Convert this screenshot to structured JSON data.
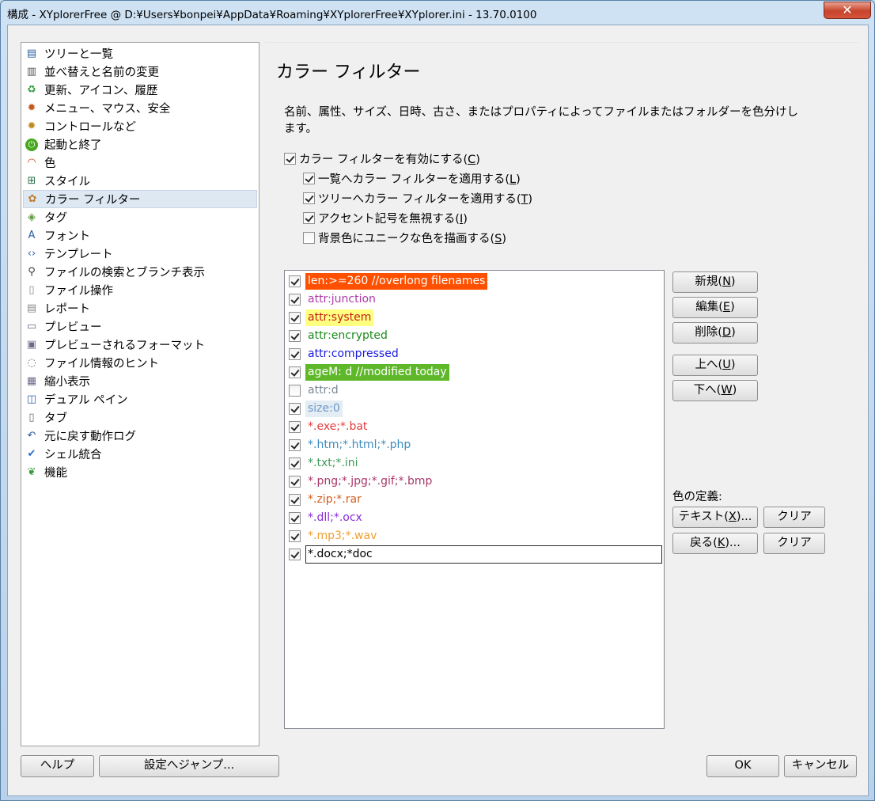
{
  "window": {
    "title": "構成 - XYplorerFree @ D:¥Users¥bonpei¥AppData¥Roaming¥XYplorerFree¥XYplorer.ini - 13.70.0100",
    "close_glyph": "✕"
  },
  "sidebar": {
    "items": [
      {
        "label": "ツリーと一覧",
        "icon": "tree-list-icon"
      },
      {
        "label": "並べ替えと名前の変更",
        "icon": "sort-icon"
      },
      {
        "label": "更新、アイコン、履歴",
        "icon": "refresh-icon"
      },
      {
        "label": "メニュー、マウス、安全",
        "icon": "menu-gear-icon"
      },
      {
        "label": "コントロールなど",
        "icon": "controls-gear-icon"
      },
      {
        "label": "起動と終了",
        "icon": "power-icon"
      },
      {
        "label": "色",
        "icon": "rainbow-icon"
      },
      {
        "label": "スタイル",
        "icon": "grid-style-icon"
      },
      {
        "label": "カラー フィルター",
        "icon": "color-filter-icon"
      },
      {
        "label": "タグ",
        "icon": "tag-icon"
      },
      {
        "label": "フォント",
        "icon": "font-icon"
      },
      {
        "label": "テンプレート",
        "icon": "code-brackets-icon"
      },
      {
        "label": "ファイルの検索とブランチ表示",
        "icon": "magnifier-icon"
      },
      {
        "label": "ファイル操作",
        "icon": "document-icon"
      },
      {
        "label": "レポート",
        "icon": "report-icon"
      },
      {
        "label": "プレビュー",
        "icon": "preview-icon"
      },
      {
        "label": "プレビューされるフォーマット",
        "icon": "formats-icon"
      },
      {
        "label": "ファイル情報のヒント",
        "icon": "speech-bubble-icon"
      },
      {
        "label": "縮小表示",
        "icon": "thumbnails-icon"
      },
      {
        "label": "デュアル ペイン",
        "icon": "dual-pane-icon"
      },
      {
        "label": "タブ",
        "icon": "tab-page-icon"
      },
      {
        "label": "元に戻す動作ログ",
        "icon": "undo-icon"
      },
      {
        "label": "シェル統合",
        "icon": "checkmark-icon"
      },
      {
        "label": "機能",
        "icon": "leaf-icon"
      }
    ],
    "selected_index": 8
  },
  "main": {
    "title": "カラー フィルター",
    "description": "名前、属性、サイズ、日時、古さ、またはプロパティによってファイルまたはフォルダーを色分けします。",
    "options": {
      "enable": {
        "label": "カラー フィルターを有効にする",
        "key": "C",
        "checked": true
      },
      "apply_list": {
        "label": "一覧へカラー フィルターを適用する",
        "key": "L",
        "checked": true
      },
      "apply_tree": {
        "label": "ツリーへカラー フィルターを適用する",
        "key": "T",
        "checked": true
      },
      "ignore_diacritics": {
        "label": "アクセント記号を無視する",
        "key": "I",
        "checked": true
      },
      "unique_bg": {
        "label": "背景色にユニークな色を描画する",
        "key": "S",
        "checked": false
      }
    },
    "filters": [
      {
        "text": "len:>=260 //overlong filenames",
        "checked": true,
        "fg": "#ffffff",
        "bg": "#ff5000"
      },
      {
        "text": "attr:junction",
        "checked": true,
        "fg": "#b03aa8",
        "bg": ""
      },
      {
        "text": "attr:system",
        "checked": true,
        "fg": "#c71c1c",
        "bg": "#ffff80"
      },
      {
        "text": "attr:encrypted",
        "checked": true,
        "fg": "#1a8a1a",
        "bg": ""
      },
      {
        "text": "attr:compressed",
        "checked": true,
        "fg": "#1a1ae0",
        "bg": ""
      },
      {
        "text": "ageM: d //modified today",
        "checked": true,
        "fg": "#ffffff",
        "bg": "#5fb82a"
      },
      {
        "text": "attr:d",
        "checked": false,
        "fg": "#7b8893",
        "bg": ""
      },
      {
        "text": "size:0",
        "checked": true,
        "fg": "#6a9ac8",
        "bg": "#e4ecf4"
      },
      {
        "text": "*.exe;*.bat",
        "checked": true,
        "fg": "#e03c3c",
        "bg": ""
      },
      {
        "text": "*.htm;*.html;*.php",
        "checked": true,
        "fg": "#3d8cbf",
        "bg": ""
      },
      {
        "text": "*.txt;*.ini",
        "checked": true,
        "fg": "#3d9a5a",
        "bg": ""
      },
      {
        "text": "*.png;*.jpg;*.gif;*.bmp",
        "checked": true,
        "fg": "#a8386a",
        "bg": ""
      },
      {
        "text": "*.zip;*.rar",
        "checked": true,
        "fg": "#d45c1a",
        "bg": ""
      },
      {
        "text": "*.dll;*.ocx",
        "checked": true,
        "fg": "#8a2bd6",
        "bg": ""
      },
      {
        "text": "*.mp3;*.wav",
        "checked": true,
        "fg": "#f0a030",
        "bg": ""
      },
      {
        "text": "*.docx;*doc",
        "checked": true,
        "fg": "#000000",
        "bg": "#ffffff",
        "editing": true
      }
    ],
    "buttons": {
      "new": {
        "label": "新規",
        "key": "N"
      },
      "edit": {
        "label": "編集",
        "key": "E"
      },
      "delete": {
        "label": "削除",
        "key": "D"
      },
      "up": {
        "label": "上へ",
        "key": "U"
      },
      "down": {
        "label": "下へ",
        "key": "W"
      }
    },
    "color_definition": {
      "label": "色の定義:",
      "text_button": {
        "label": "テキスト",
        "key": "X",
        "suffix": "..."
      },
      "back_button": {
        "label": "戻る",
        "key": "K",
        "suffix": "..."
      },
      "clear_label": "クリア"
    }
  },
  "footer": {
    "help": "ヘルプ",
    "jump": "設定へジャンプ...",
    "ok": "OK",
    "cancel": "キャンセル"
  }
}
